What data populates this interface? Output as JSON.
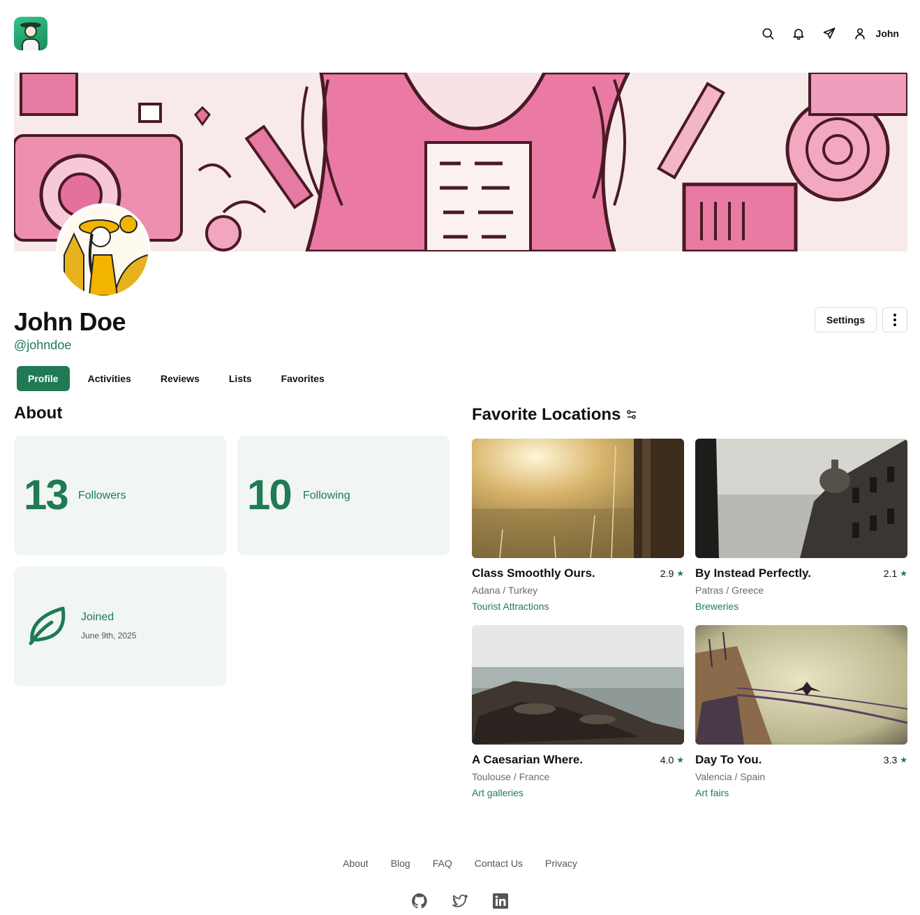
{
  "header": {
    "user_name": "John",
    "icons": [
      "search-icon",
      "bell-icon",
      "send-icon",
      "user-icon"
    ]
  },
  "profile": {
    "name": "John Doe",
    "handle": "@johndoe",
    "settings_label": "Settings"
  },
  "tabs": [
    {
      "label": "Profile",
      "active": true
    },
    {
      "label": "Activities",
      "active": false
    },
    {
      "label": "Reviews",
      "active": false
    },
    {
      "label": "Lists",
      "active": false
    },
    {
      "label": "Favorites",
      "active": false
    }
  ],
  "about": {
    "title": "About",
    "followers_count": "13",
    "followers_label": "Followers",
    "following_count": "10",
    "following_label": "Following",
    "joined_label": "Joined",
    "joined_date": "June 9th, 2025"
  },
  "favorites": {
    "title": "Favorite Locations",
    "items": [
      {
        "title": "Class Smoothly Ours.",
        "rating": "2.9",
        "place": "Adana / Turkey",
        "category": "Tourist Attractions"
      },
      {
        "title": "By Instead Perfectly.",
        "rating": "2.1",
        "place": "Patras / Greece",
        "category": "Breweries"
      },
      {
        "title": "A Caesarian Where.",
        "rating": "4.0",
        "place": "Toulouse / France",
        "category": "Art galleries"
      },
      {
        "title": "Day To You.",
        "rating": "3.3",
        "place": "Valencia / Spain",
        "category": "Art fairs"
      }
    ]
  },
  "footer": {
    "links": [
      "About",
      "Blog",
      "FAQ",
      "Contact Us",
      "Privacy"
    ],
    "social": [
      "github-icon",
      "twitter-icon",
      "linkedin-icon"
    ]
  },
  "colors": {
    "accent": "#1f7a55",
    "card_bg": "#f1f5f3"
  }
}
